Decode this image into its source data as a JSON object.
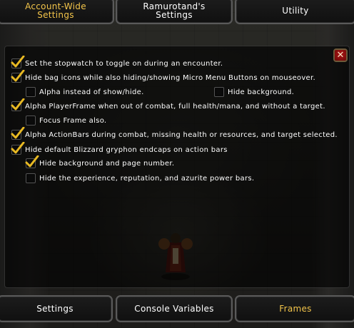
{
  "tabs_top": [
    {
      "label_line1": "Account-Wide",
      "label_line2": "Settings",
      "active": true
    },
    {
      "label_line1": "Ramurotand's",
      "label_line2": "Settings",
      "active": false
    },
    {
      "label_line1": "Utility",
      "label_line2": "",
      "active": false
    }
  ],
  "tabs_bottom": [
    {
      "label": "Settings",
      "active": false
    },
    {
      "label": "Console Variables",
      "active": false
    },
    {
      "label": "Frames",
      "active": true
    }
  ],
  "close_label": "✕",
  "options": [
    {
      "label": "Set the stopwatch to toggle on during an encounter.",
      "checked": true
    },
    {
      "label": "Hide bag icons while also hiding/showing Micro Menu Buttons on mouseover.",
      "checked": true
    },
    {
      "label": "Alpha instead of show/hide.",
      "checked": false
    },
    {
      "label": "Hide background.",
      "checked": false
    },
    {
      "label": "Alpha PlayerFrame when out of combat, full health/mana, and without a target.",
      "checked": true
    },
    {
      "label": "Focus Frame also.",
      "checked": false
    },
    {
      "label": "Alpha ActionBars during combat, missing health or resources, and target selected.",
      "checked": true
    },
    {
      "label": "Hide default Blizzard gryphon endcaps on action bars",
      "checked": true
    },
    {
      "label": "Hide background and page number.",
      "checked": true
    },
    {
      "label": "Hide the experience, reputation, and azurite power bars.",
      "checked": false
    }
  ],
  "colors": {
    "active_tab_text": "#f2c44a",
    "checkmark": "#e8b923",
    "close_button": "#b01515"
  }
}
